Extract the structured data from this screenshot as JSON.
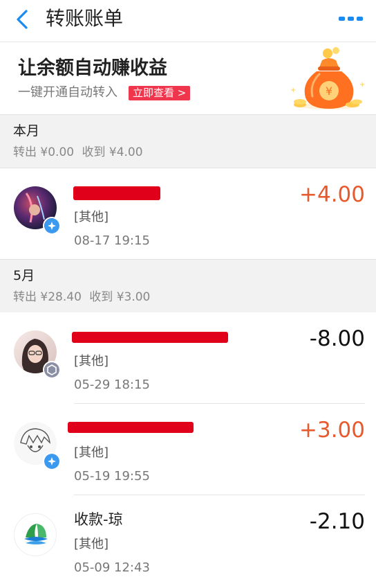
{
  "header": {
    "title": "转账账单"
  },
  "banner": {
    "title": "让余额自动赚收益",
    "subtitle": "一键开通自动转入",
    "button_label": "立即查看 >"
  },
  "sections": [
    {
      "month": "本月",
      "out_label": "转出 ¥0.00",
      "in_label": "收到 ¥4.00",
      "items": [
        {
          "name": "",
          "category": "[其他]",
          "time": "08-17  19:15",
          "amount": "+4.00"
        }
      ]
    },
    {
      "month": "5月",
      "out_label": "转出 ¥28.40",
      "in_label": "收到 ¥3.00",
      "items": [
        {
          "name": "",
          "category": "[其他]",
          "time": "05-29  18:15",
          "amount": "-8.00"
        },
        {
          "name": "",
          "category": "[其他]",
          "time": "05-19  19:55",
          "amount": "+3.00"
        },
        {
          "name": "收款-琼",
          "category": "[其他]",
          "time": "05-09  12:43",
          "amount": "-2.10"
        }
      ]
    }
  ],
  "colors": {
    "accent": "#1a8bf0",
    "positive": "#e65a2e",
    "negative": "#111111",
    "banner_button": "#f0364d"
  },
  "icons": [
    "back-arrow-icon",
    "more-dots-icon",
    "money-bag-icon",
    "verified-badge-icon",
    "member-badge-icon"
  ]
}
